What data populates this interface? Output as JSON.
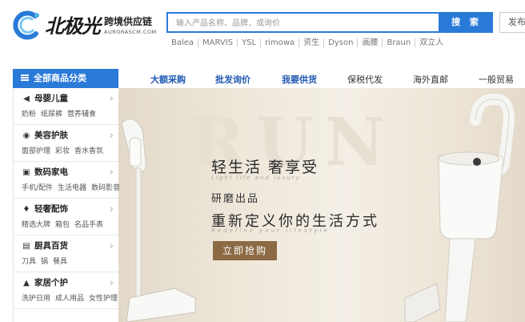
{
  "logo": {
    "name": "北极光",
    "tagline": "跨境供应链",
    "domain": "AURORASCM.COM"
  },
  "search": {
    "placeholder": "输入产品名称、品牌，或询价",
    "button_label": "搜 索"
  },
  "publish_button": "发布",
  "hot_brands": [
    "Balea",
    "MARVIS",
    "YSL",
    "rimowa",
    "资生",
    "Dyson",
    "画腰",
    "Braun",
    "双立人"
  ],
  "nav": {
    "all_categories_label": "全部商品分类",
    "links": [
      {
        "label": "大额采购",
        "style": "blue"
      },
      {
        "label": "批发询价",
        "style": "blue"
      },
      {
        "label": "我要供货",
        "style": "blue"
      },
      {
        "label": "保税代发",
        "style": "dark"
      },
      {
        "label": "海外直邮",
        "style": "dark"
      },
      {
        "label": "一般贸易",
        "style": "dark"
      }
    ]
  },
  "categories": [
    {
      "title": "母婴儿童",
      "icon": "bottle-icon",
      "subs": [
        "奶粉",
        "纸尿裤",
        "营养辅食"
      ]
    },
    {
      "title": "美容护肤",
      "icon": "face-icon",
      "subs": [
        "面部护理",
        "彩妆",
        "香水香氛"
      ]
    },
    {
      "title": "数码家电",
      "icon": "camera-icon",
      "subs": [
        "手机/配件",
        "生活电器",
        "数码影音"
      ]
    },
    {
      "title": "轻奢配饰",
      "icon": "diamond-icon",
      "subs": [
        "精选大牌",
        "箱包",
        "名品手表"
      ]
    },
    {
      "title": "厨具百货",
      "icon": "pot-icon",
      "subs": [
        "刀具",
        "锅",
        "餐具"
      ]
    },
    {
      "title": "家居个护",
      "icon": "bottle-pump-icon",
      "subs": [
        "洗护日用",
        "成人用品",
        "女性护理"
      ]
    }
  ],
  "banner": {
    "watermark": "RUN",
    "title": "轻生活 奢享受",
    "en_line1": "Light life and luxury",
    "subtitle": "研磨出品",
    "headline": "重新定义你的生活方式",
    "en_line2": "Redefine your lifestyle",
    "cta_label": "立即抢购"
  },
  "colors": {
    "brand_blue": "#2a7ad8",
    "nav_blue": "#2159b2",
    "cta_brown": "#8b6a44",
    "banner_bg": "#eee7da"
  }
}
